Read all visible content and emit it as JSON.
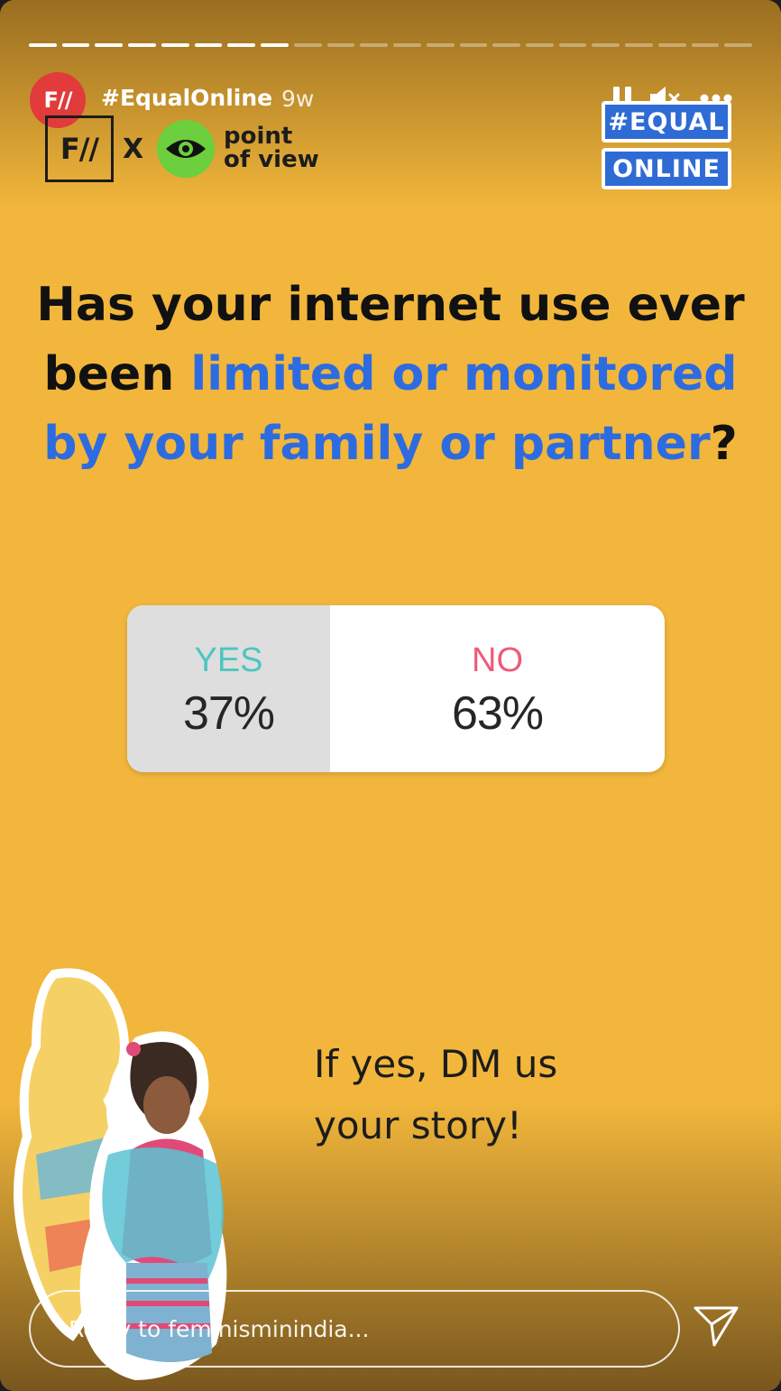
{
  "header": {
    "avatar_text": "F//",
    "account_name": "#EqualOnline",
    "post_age": "9w",
    "progress": {
      "segments": 22,
      "completed": 8
    }
  },
  "brand": {
    "fii_logo_text": "F//",
    "collab_x": "X",
    "pov_text": "point of view",
    "badge_line_1": "#EQUAL",
    "badge_line_2": "ONLINE"
  },
  "question": {
    "part_1": "Has your internet use ever been ",
    "highlight": "limited or monitored by your family or partner",
    "part_2": "?"
  },
  "poll": {
    "options": [
      {
        "label": "YES",
        "percent": "37%",
        "share": 0.37
      },
      {
        "label": "NO",
        "percent": "63%",
        "share": 0.63
      }
    ]
  },
  "cta": {
    "line_1": "If yes, DM us",
    "line_2": "your story!"
  },
  "reply": {
    "placeholder": "Reply to feminisminindia..."
  },
  "colors": {
    "background": "#f1b63b",
    "highlight_blue": "#2d6be0",
    "yes_color": "#4cc6c0",
    "no_color": "#ef5a7a",
    "avatar_red": "#e23b3b"
  },
  "icons": [
    "pause-icon",
    "mute-icon",
    "more-icon",
    "send-icon"
  ]
}
